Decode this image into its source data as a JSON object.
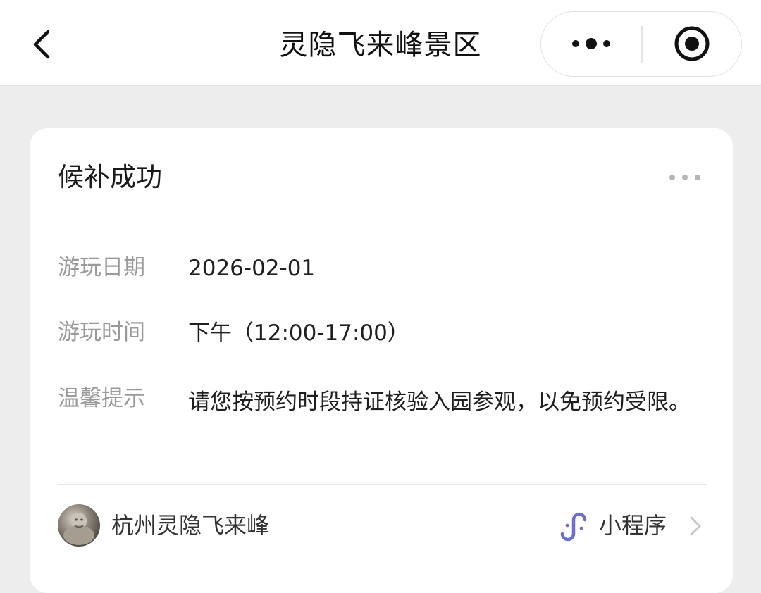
{
  "nav": {
    "title": "灵隐飞来峰景区",
    "back_icon": "chevron-left-icon",
    "more_icon": "more-dots-icon",
    "close_icon": "target-circle-icon"
  },
  "card": {
    "title": "候补成功",
    "more_icon": "ellipsis-icon",
    "rows": [
      {
        "label": "游玩日期",
        "value": "2026-02-01"
      },
      {
        "label": "游玩时间",
        "value": "下午（12:00-17:00）"
      },
      {
        "label": "温馨提示",
        "value": "请您按预约时段持证核验入园参观，以免预约受限。"
      }
    ],
    "footer": {
      "name": "杭州灵隐飞来峰",
      "mini_program_label": "小程序",
      "mini_program_icon": "mini-program-icon",
      "accent_color": "#6b6fd1",
      "chevron_icon": "chevron-right-icon"
    }
  }
}
